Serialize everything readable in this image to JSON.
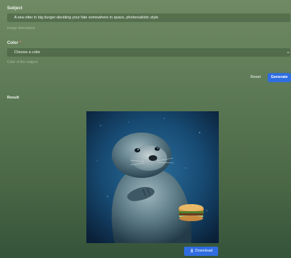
{
  "subject": {
    "label": "Subject",
    "value": "A sea otter in big burger deciding your fate somewhere in space, photorealistic style",
    "hint": "Image description"
  },
  "color": {
    "label": "Color",
    "required_mark": "*",
    "selected": "Choose a color",
    "hint": "Color of the subject"
  },
  "actions": {
    "reset_label": "Reset",
    "generate_label": "Generate"
  },
  "result": {
    "label": "Result",
    "image_icon": "otter-with-burger-image",
    "download_label": "Download",
    "download_icon": "download-icon"
  },
  "colors": {
    "primary": "#2f6de0",
    "required": "#e96b6b"
  }
}
